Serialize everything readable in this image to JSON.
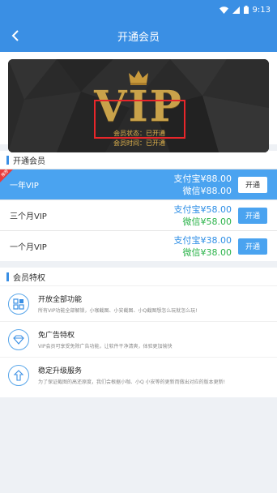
{
  "status_bar": {
    "time": "9:13"
  },
  "header": {
    "title": "开通会员"
  },
  "banner": {
    "badge": "VIP",
    "status_line": "会员状态：已开通",
    "time_line": "会员时间：已开通"
  },
  "plans_section": {
    "title": "开通会员",
    "plans": [
      {
        "name": "一年VIP",
        "alipay": "支付宝¥88.00",
        "wechat": "微信¥88.00",
        "button": "开通",
        "ribbon": "推荐"
      },
      {
        "name": "三个月VIP",
        "alipay": "支付宝¥58.00",
        "wechat": "微信¥58.00",
        "button": "开通"
      },
      {
        "name": "一个月VIP",
        "alipay": "支付宝¥38.00",
        "wechat": "微信¥38.00",
        "button": "开通"
      }
    ]
  },
  "privileges_section": {
    "title": "会员特权",
    "items": [
      {
        "title": "开放全部功能",
        "desc": "所有VIP功能全部解锁，小咖截图、小安截图、小Q截图想怎么玩就怎么玩!"
      },
      {
        "title": "免广告特权",
        "desc": "VIP会员可享受免除广告功能，让软件干净清爽，体验更加愉快"
      },
      {
        "title": "稳定升级服务",
        "desc": "为了保证截图的高还原度，我们会根据小咖、小Q 小安等的更新而做出对应的版本更新!"
      }
    ]
  },
  "colors": {
    "primary": "#3a8fe4",
    "alipay": "#2d8ee6",
    "wechat": "#2bb34a",
    "gold": "#c9a24a",
    "highlight_box": "#e8262a"
  }
}
